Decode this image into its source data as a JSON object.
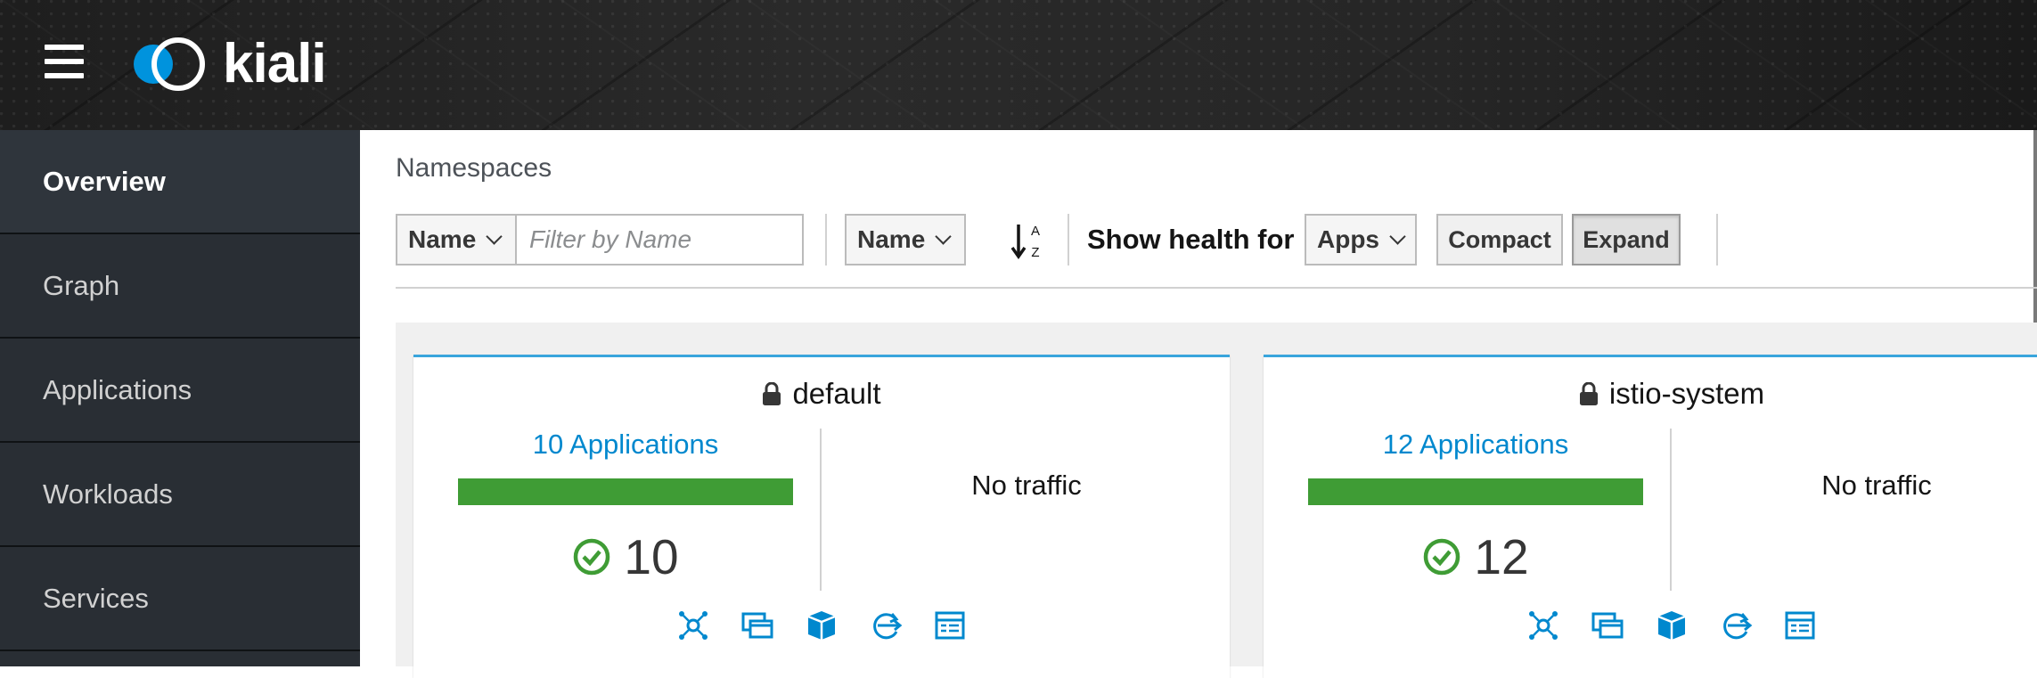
{
  "brand": {
    "logo_text": "kiali"
  },
  "sidebar": {
    "items": [
      {
        "label": "Overview"
      },
      {
        "label": "Graph"
      },
      {
        "label": "Applications"
      },
      {
        "label": "Workloads"
      },
      {
        "label": "Services"
      }
    ],
    "active": "Overview"
  },
  "main": {
    "title": "Namespaces",
    "filter": {
      "type_label": "Name",
      "placeholder": "Filter by Name"
    },
    "sort": {
      "field_label": "Name"
    },
    "health": {
      "label": "Show health for",
      "value": "Apps"
    },
    "view": {
      "compact_label": "Compact",
      "expand_label": "Expand",
      "selected": "Expand"
    }
  },
  "cards": [
    {
      "name": "default",
      "apps_link": "10 Applications",
      "healthy_count": "10",
      "traffic": "No traffic",
      "health_fraction_healthy": 1.0
    },
    {
      "name": "istio-system",
      "apps_link": "12 Applications",
      "healthy_count": "12",
      "traffic": "No traffic",
      "health_fraction_healthy": 1.0
    }
  ],
  "colors": {
    "accent": "#0088ce",
    "healthy": "#3f9c35",
    "card_top": "#39a5dc",
    "sidebar_bg": "#292e34"
  }
}
